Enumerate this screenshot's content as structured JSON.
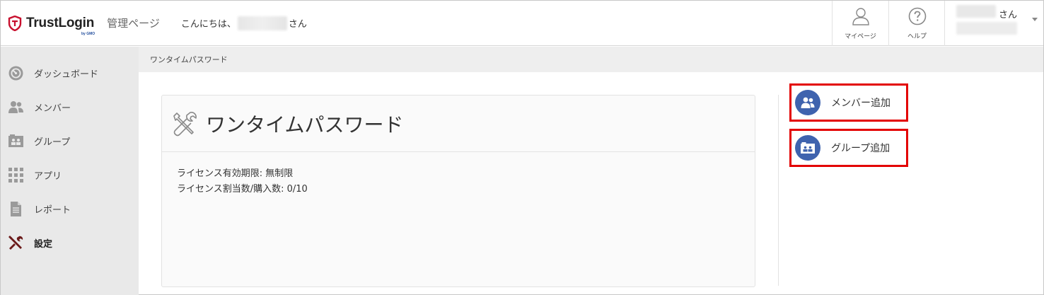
{
  "header": {
    "logo_text": "TrustLogin",
    "logo_sub": "by GMO",
    "admin_label": "管理ページ",
    "greeting_prefix": "こんにちは、",
    "greeting_suffix": "さん",
    "mypage_label": "マイページ",
    "help_label": "ヘルプ",
    "user_suffix": "さん"
  },
  "sidebar": {
    "items": [
      {
        "label": "ダッシュボード",
        "icon": "dashboard-icon"
      },
      {
        "label": "メンバー",
        "icon": "members-icon"
      },
      {
        "label": "グループ",
        "icon": "group-icon"
      },
      {
        "label": "アプリ",
        "icon": "apps-grid-icon"
      },
      {
        "label": "レポート",
        "icon": "report-icon"
      },
      {
        "label": "設定",
        "icon": "settings-tools-icon",
        "active": true
      }
    ]
  },
  "breadcrumb": "ワンタイムパスワード",
  "main": {
    "title": "ワンタイムパスワード",
    "license_expiry": "ライセンス有効期限: 無制限",
    "license_alloc": "ライセンス割当数/購入数: 0/10"
  },
  "actions": {
    "add_member": "メンバー追加",
    "add_group": "グループ追加"
  },
  "colors": {
    "accent_blue": "#3f63ae",
    "highlight_red": "#e30000",
    "logo_red": "#c8102e",
    "active_icon": "#6b1a1a"
  }
}
